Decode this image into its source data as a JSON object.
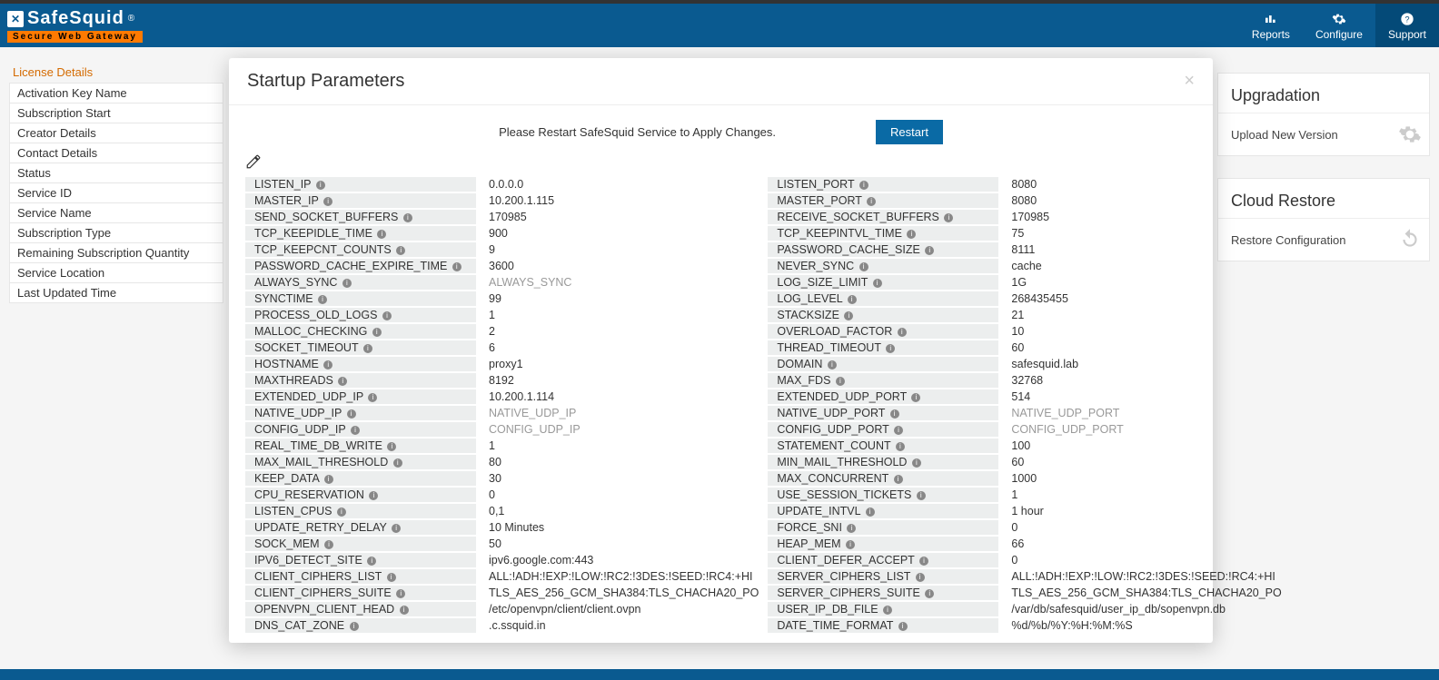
{
  "brand": {
    "name": "SafeSquid",
    "reg": "®",
    "tagline": "Secure Web Gateway"
  },
  "topnav": {
    "reports": "Reports",
    "configure": "Configure",
    "support": "Support"
  },
  "sidebar": {
    "header": "License Details",
    "items": [
      "Activation Key Name",
      "Subscription Start",
      "Creator Details",
      "Contact Details",
      "Status",
      "Service ID",
      "Service Name",
      "Subscription Type",
      "Remaining Subscription Quantity",
      "Service Location",
      "Last Updated Time"
    ]
  },
  "right": {
    "card1_title": "Upgradation",
    "card1_row": "Upload New Version",
    "card2_title": "Cloud Restore",
    "card2_row": "Restore Configuration"
  },
  "modal": {
    "title": "Startup Parameters",
    "restart_msg": "Please Restart SafeSquid Service to Apply Changes.",
    "restart_btn": "Restart"
  },
  "left_params": [
    {
      "k": "LISTEN_IP",
      "v": "0.0.0.0"
    },
    {
      "k": "MASTER_IP",
      "v": "10.200.1.115"
    },
    {
      "k": "SEND_SOCKET_BUFFERS",
      "v": "170985"
    },
    {
      "k": "TCP_KEEPIDLE_TIME",
      "v": "900"
    },
    {
      "k": "TCP_KEEPCNT_COUNTS",
      "v": "9"
    },
    {
      "k": "PASSWORD_CACHE_EXPIRE_TIME",
      "v": "3600"
    },
    {
      "k": "ALWAYS_SYNC",
      "v": "ALWAYS_SYNC",
      "ph": true
    },
    {
      "k": "SYNCTIME",
      "v": "99"
    },
    {
      "k": "PROCESS_OLD_LOGS",
      "v": "1"
    },
    {
      "k": "MALLOC_CHECKING",
      "v": "2"
    },
    {
      "k": "SOCKET_TIMEOUT",
      "v": "6"
    },
    {
      "k": "HOSTNAME",
      "v": "proxy1"
    },
    {
      "k": "MAXTHREADS",
      "v": "8192"
    },
    {
      "k": "EXTENDED_UDP_IP",
      "v": "10.200.1.114"
    },
    {
      "k": "NATIVE_UDP_IP",
      "v": "NATIVE_UDP_IP",
      "ph": true
    },
    {
      "k": "CONFIG_UDP_IP",
      "v": "CONFIG_UDP_IP",
      "ph": true
    },
    {
      "k": "REAL_TIME_DB_WRITE",
      "v": "1"
    },
    {
      "k": "MAX_MAIL_THRESHOLD",
      "v": "80"
    },
    {
      "k": "KEEP_DATA",
      "v": "30"
    },
    {
      "k": "CPU_RESERVATION",
      "v": "0"
    },
    {
      "k": "LISTEN_CPUS",
      "v": "0,1"
    },
    {
      "k": "UPDATE_RETRY_DELAY",
      "v": "10 Minutes"
    },
    {
      "k": "SOCK_MEM",
      "v": "50"
    },
    {
      "k": "IPV6_DETECT_SITE",
      "v": "ipv6.google.com:443"
    },
    {
      "k": "CLIENT_CIPHERS_LIST",
      "v": "ALL:!ADH:!EXP:!LOW:!RC2:!3DES:!SEED:!RC4:+HI"
    },
    {
      "k": "CLIENT_CIPHERS_SUITE",
      "v": "TLS_AES_256_GCM_SHA384:TLS_CHACHA20_PO"
    },
    {
      "k": "OPENVPN_CLIENT_HEAD",
      "v": "/etc/openvpn/client/client.ovpn"
    },
    {
      "k": "DNS_CAT_ZONE",
      "v": ".c.ssquid.in"
    }
  ],
  "right_params": [
    {
      "k": "LISTEN_PORT",
      "v": "8080"
    },
    {
      "k": "MASTER_PORT",
      "v": "8080"
    },
    {
      "k": "RECEIVE_SOCKET_BUFFERS",
      "v": "170985"
    },
    {
      "k": "TCP_KEEPINTVL_TIME",
      "v": "75"
    },
    {
      "k": "PASSWORD_CACHE_SIZE",
      "v": "8111"
    },
    {
      "k": "NEVER_SYNC",
      "v": "cache"
    },
    {
      "k": "LOG_SIZE_LIMIT",
      "v": "1G"
    },
    {
      "k": "LOG_LEVEL",
      "v": "268435455"
    },
    {
      "k": "STACKSIZE",
      "v": "21"
    },
    {
      "k": "OVERLOAD_FACTOR",
      "v": "10"
    },
    {
      "k": "THREAD_TIMEOUT",
      "v": "60"
    },
    {
      "k": "DOMAIN",
      "v": "safesquid.lab"
    },
    {
      "k": "MAX_FDS",
      "v": "32768"
    },
    {
      "k": "EXTENDED_UDP_PORT",
      "v": "514"
    },
    {
      "k": "NATIVE_UDP_PORT",
      "v": "NATIVE_UDP_PORT",
      "ph": true
    },
    {
      "k": "CONFIG_UDP_PORT",
      "v": "CONFIG_UDP_PORT",
      "ph": true
    },
    {
      "k": "STATEMENT_COUNT",
      "v": "100"
    },
    {
      "k": "MIN_MAIL_THRESHOLD",
      "v": "60"
    },
    {
      "k": "MAX_CONCURRENT",
      "v": "1000"
    },
    {
      "k": "USE_SESSION_TICKETS",
      "v": "1"
    },
    {
      "k": "UPDATE_INTVL",
      "v": "1 hour"
    },
    {
      "k": "FORCE_SNI",
      "v": "0"
    },
    {
      "k": "HEAP_MEM",
      "v": "66"
    },
    {
      "k": "CLIENT_DEFER_ACCEPT",
      "v": "0"
    },
    {
      "k": "SERVER_CIPHERS_LIST",
      "v": "ALL:!ADH:!EXP:!LOW:!RC2:!3DES:!SEED:!RC4:+HI"
    },
    {
      "k": "SERVER_CIPHERS_SUITE",
      "v": "TLS_AES_256_GCM_SHA384:TLS_CHACHA20_PO"
    },
    {
      "k": "USER_IP_DB_FILE",
      "v": "/var/db/safesquid/user_ip_db/sopenvpn.db"
    },
    {
      "k": "DATE_TIME_FORMAT",
      "v": "%d/%b/%Y:%H:%M:%S"
    }
  ]
}
